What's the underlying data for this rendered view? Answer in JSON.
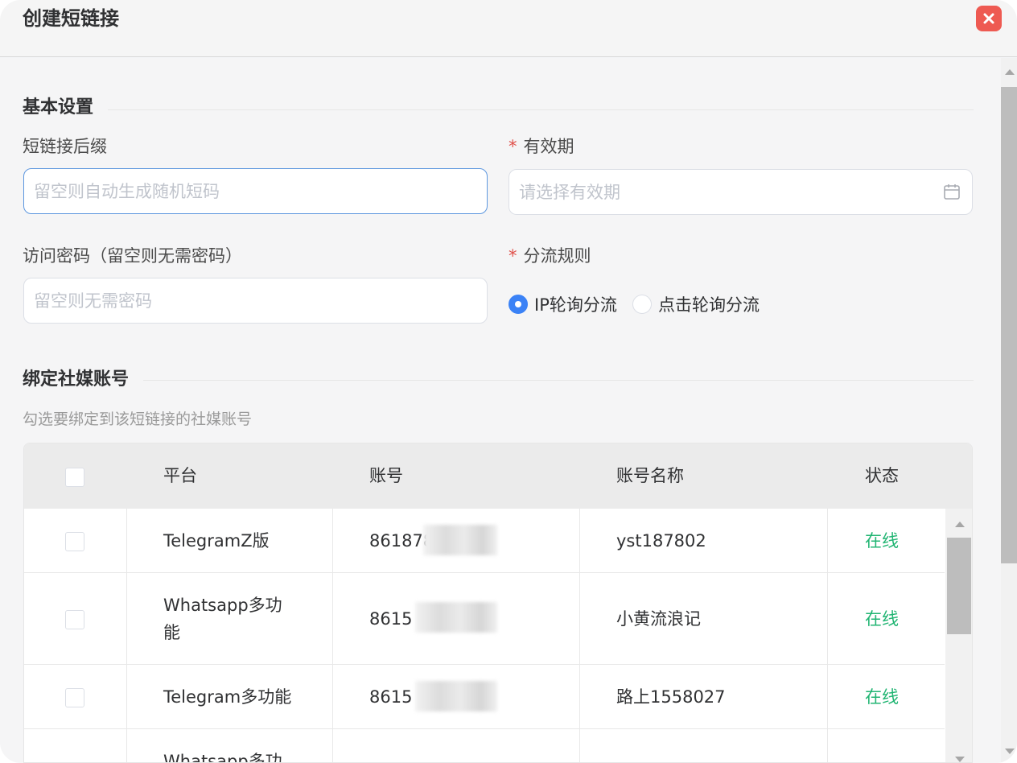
{
  "dialog": {
    "title": "创建短链接"
  },
  "basic": {
    "section_title": "基本设置",
    "suffix": {
      "label": "短链接后缀",
      "placeholder": "留空则自动生成随机短码",
      "value": ""
    },
    "expiry": {
      "required_mark": "*",
      "label": "有效期",
      "placeholder": "请选择有效期",
      "icon": "calendar-icon"
    },
    "password": {
      "label": "访问密码（留空则无需密码）",
      "placeholder": "留空则无需密码",
      "value": ""
    },
    "routing": {
      "required_mark": "*",
      "label": "分流规则",
      "options": [
        {
          "label": "IP轮询分流",
          "checked": true
        },
        {
          "label": "点击轮询分流",
          "checked": false
        }
      ]
    }
  },
  "bind": {
    "section_title": "绑定社媒账号",
    "hint": "勾选要绑定到该短链接的社媒账号",
    "columns": [
      "平台",
      "账号",
      "账号名称",
      "状态"
    ],
    "rows": [
      {
        "platform": "TelegramZ版",
        "account": "861878",
        "name": "yst187802",
        "status": "在线"
      },
      {
        "platform": "Whatsapp多功能",
        "account": "8615",
        "name": "小黄流浪记",
        "status": "在线"
      },
      {
        "platform": "Telegram多功能",
        "account": "8615",
        "name": "路上1558027",
        "status": "在线"
      },
      {
        "platform": "Whatsapp多功",
        "account": "",
        "name": "",
        "status": ""
      }
    ],
    "status_color": "#22b573"
  },
  "colors": {
    "accent": "#3b82f6",
    "close": "#ee5a52",
    "required": "#e0504a"
  }
}
